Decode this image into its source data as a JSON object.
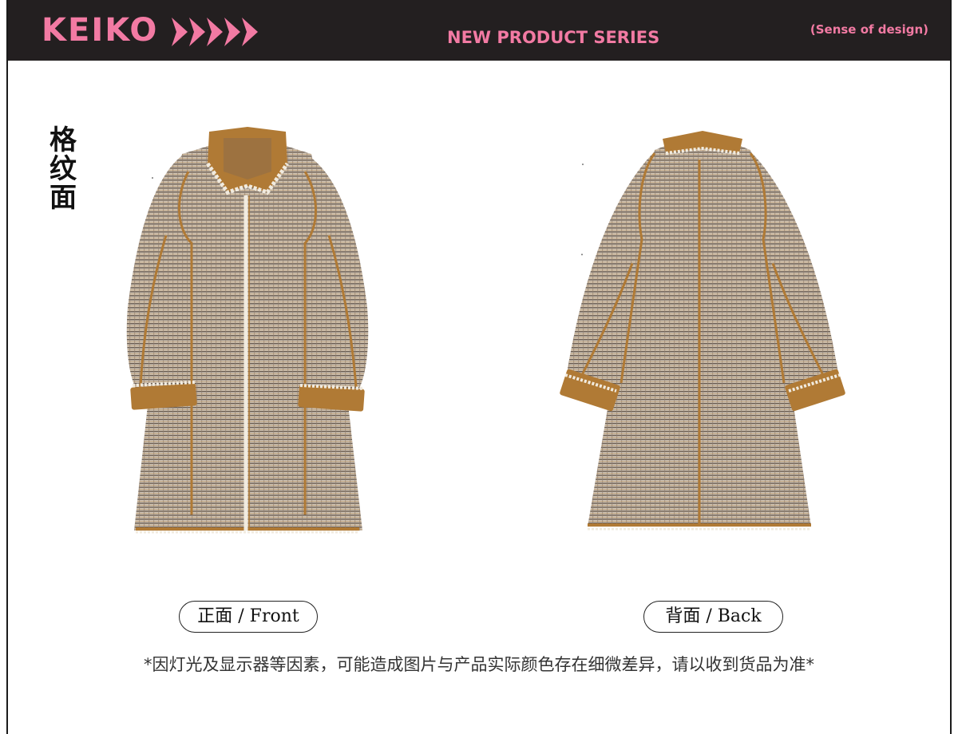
{
  "header": {
    "brand": "KEIKO",
    "series": "NEW PRODUCT SERIES",
    "tagline": "(Sense of design)",
    "arrows_icon": "five-pink-arrows-icon"
  },
  "side_label": [
    "格",
    "纹",
    "面"
  ],
  "views": {
    "front_label": "正面 / Front",
    "back_label": "背面 / Back"
  },
  "disclaimer": "*因灯光及显示器等因素，可能造成图片与产品实际颜色存在细微差异，请以收到货品为准*",
  "colors": {
    "header_bg": "#231f20",
    "accent_pink": "#f27aa3",
    "camel": "#b07a35",
    "plaid_light": "#cfc3b4",
    "plaid_dark": "#5a4e45",
    "trim_cream": "#f1ebdf"
  }
}
